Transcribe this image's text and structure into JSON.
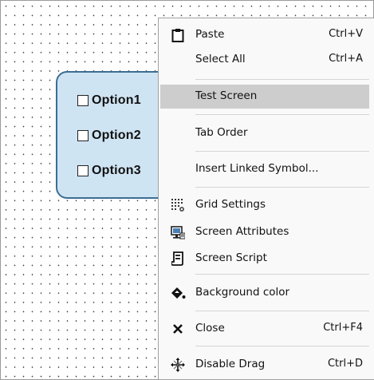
{
  "checkboxes": [
    "Option1",
    "Option2",
    "Option3"
  ],
  "menu": {
    "paste": {
      "label": "Paste",
      "shortcut": "Ctrl+V",
      "icon": "clipboard-icon"
    },
    "select_all": {
      "label": "Select All",
      "shortcut": "Ctrl+A"
    },
    "test_screen": {
      "label": "Test Screen"
    },
    "tab_order": {
      "label": "Tab Order"
    },
    "insert_linked_symbol": {
      "label": "Insert Linked Symbol..."
    },
    "grid_settings": {
      "label": "Grid Settings",
      "icon": "grid-settings-icon"
    },
    "screen_attributes": {
      "label": "Screen Attributes",
      "icon": "screen-attributes-icon"
    },
    "screen_script": {
      "label": "Screen Script",
      "icon": "script-icon"
    },
    "background_color": {
      "label": "Background color",
      "icon": "paint-bucket-icon"
    },
    "close": {
      "label": "Close",
      "shortcut": "Ctrl+F4",
      "icon": "close-icon"
    },
    "disable_drag": {
      "label": "Disable Drag",
      "shortcut": "Ctrl+D",
      "icon": "move-icon"
    }
  }
}
